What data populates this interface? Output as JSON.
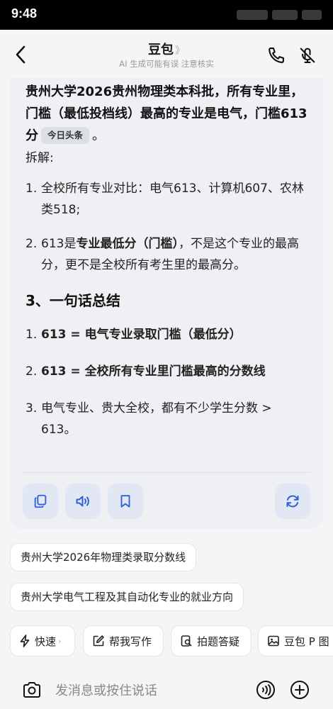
{
  "status_bar": {
    "time": "9:48"
  },
  "header": {
    "title": "豆包",
    "title_chevron": "》",
    "subtitle": "AI 生成可能有误 注意核实",
    "icons": [
      "back-arrow-icon",
      "phone-icon",
      "mute-icon"
    ]
  },
  "answer": {
    "lead": "贵州大学2026贵州物理类本科批，所有专业里，门槛（最低投档线）最高的专业是电气，门槛613分",
    "source_tag": "今日头条",
    "lead_end": "。",
    "breakdown_label": "拆解:",
    "breakdown_items": [
      {
        "num": "1.",
        "text": "全校所有专业对比：电气613、计算机607、农林类518;"
      },
      {
        "num": "2.",
        "pre": "613是",
        "bold": "专业最低分（门槛）",
        "post": "，不是这个专业的最高分，更不是全校所有考生里的最高分。"
      }
    ],
    "summary_heading": "3、一句话总结",
    "summary_items": [
      {
        "num": "1.",
        "text": "613 = 电气专业录取门槛（最低分）"
      },
      {
        "num": "2.",
        "text": "613 = 全校所有专业里门槛最高的分数线"
      },
      {
        "num": "3.",
        "text": "电气专业、贵大全校，都有不少学生分数 > 613。"
      }
    ],
    "actions": [
      "copy-icon",
      "speaker-icon",
      "bookmark-icon",
      "refresh-icon"
    ]
  },
  "suggestions": [
    "贵州大学2026年物理类录取分数线",
    "贵州大学电气工程及其自动化专业的就业方向"
  ],
  "tools": [
    {
      "label": "快速",
      "icon": "lightning-icon",
      "chevron": "›"
    },
    {
      "label": "帮我写作",
      "icon": "edit-icon"
    },
    {
      "label": "拍题答疑",
      "icon": "scan-question-icon"
    },
    {
      "label": "豆包 P 图",
      "icon": "image-edit-icon"
    }
  ],
  "composer": {
    "placeholder": "发消息或按住说话",
    "icons": [
      "camera-icon",
      "voice-icon",
      "plus-icon"
    ]
  }
}
